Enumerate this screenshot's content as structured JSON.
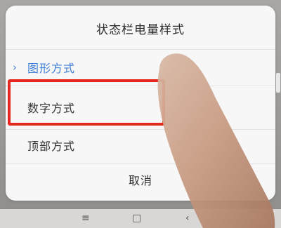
{
  "dialog": {
    "title": "状态栏电量样式",
    "options": [
      {
        "label": "图形方式",
        "selected": true
      },
      {
        "label": "数字方式",
        "selected": false
      },
      {
        "label": "顶部方式",
        "selected": false
      }
    ],
    "cancel_label": "取消"
  },
  "icons": {
    "chevron": "chevron-right-icon",
    "nav_menu": "menu-icon",
    "nav_home": "home-icon",
    "nav_back": "back-icon"
  },
  "colors": {
    "accent": "#3f7fd6",
    "highlight": "#e3261e"
  },
  "overlay": {
    "highlight_label": "数字方式"
  }
}
